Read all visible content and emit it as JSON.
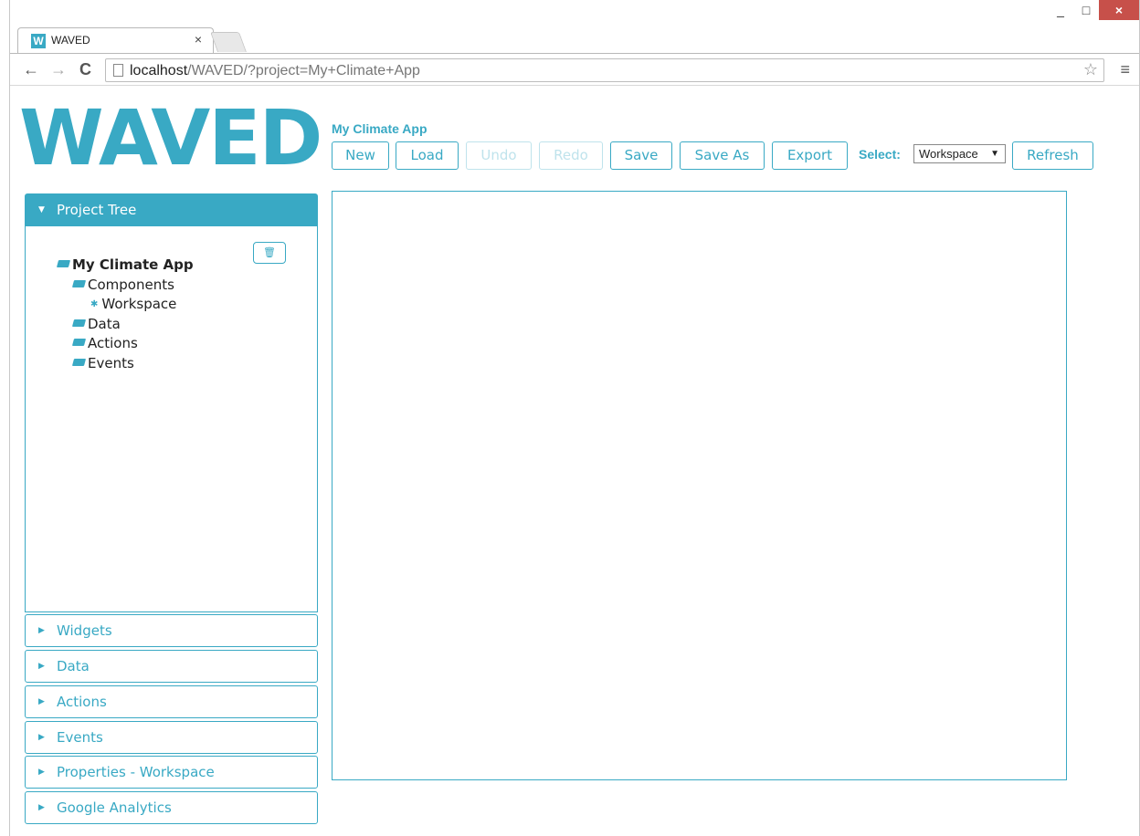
{
  "browser": {
    "tab_title": "WAVED",
    "tab_favicon_letter": "W",
    "tab_close": "×",
    "url_host": "localhost",
    "url_path": "/WAVED/?project=My+Climate+App",
    "back": "←",
    "forward": "→",
    "reload": "C",
    "star": "☆",
    "menu": "≡",
    "minimize": "_",
    "maximize": "□",
    "close": "×"
  },
  "app": {
    "logo": "WAVED",
    "project_name": "My Climate App",
    "buttons": {
      "new": "New",
      "load": "Load",
      "undo": "Undo",
      "redo": "Redo",
      "save": "Save",
      "save_as": "Save As",
      "export": "Export",
      "refresh": "Refresh"
    },
    "select_label": "Select:",
    "select_value": "Workspace",
    "select_arrow": "▼",
    "accent_color": "#39a9c4"
  },
  "sidebar": {
    "project_tree": {
      "label": "Project Tree",
      "caret": "▼",
      "trash_icon": "🗑",
      "tree": {
        "root": "My Climate App",
        "components": "Components",
        "workspace": "Workspace",
        "data": "Data",
        "actions": "Actions",
        "events": "Events"
      }
    },
    "panels": [
      {
        "label": "Widgets",
        "caret": "▶"
      },
      {
        "label": "Data",
        "caret": "▶"
      },
      {
        "label": "Actions",
        "caret": "▶"
      },
      {
        "label": "Events",
        "caret": "▶"
      },
      {
        "label": "Properties - Workspace",
        "caret": "▶"
      },
      {
        "label": "Google Analytics",
        "caret": "▶"
      }
    ]
  }
}
